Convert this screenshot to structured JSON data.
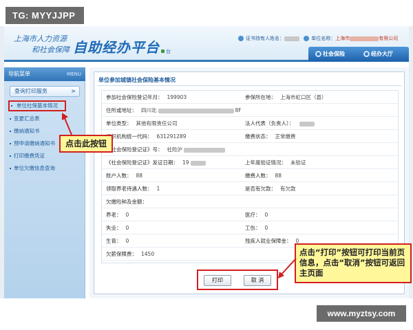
{
  "watermark_top": "TG: MYYJJPP",
  "watermark_bottom": "www.myztsy.com",
  "header": {
    "logo_line1": "上海市人力资源",
    "logo_line2": "和社会保障",
    "app_title": "自助经办平台",
    "sound_label": "台",
    "user_label": "证书持有人姓名：",
    "company_label": "单位名称：",
    "company_value": "上海市",
    "company_suffix": "有限公司"
  },
  "nav": [
    {
      "label": "社会保险"
    },
    {
      "label": "经办大厅"
    }
  ],
  "sidebar": {
    "title": "导航菜单",
    "menu_label": "MENU",
    "group_label": "查询打印服务",
    "items": [
      {
        "label": "单位社保基本情况"
      },
      {
        "label": "变更汇总表"
      },
      {
        "label": "缴纳通知书"
      },
      {
        "label": "预申请缴纳通知书"
      },
      {
        "label": "打印缴费凭证"
      },
      {
        "label": "单位欠缴信息查询"
      }
    ]
  },
  "panel": {
    "title": "单位参加城镇社会保险基本情况",
    "rows": [
      {
        "l1": "参加社会保险登记年月：",
        "v1": "199903",
        "l2": "参保所在地：",
        "v2": "上海市虹口区（县）"
      },
      {
        "l1": "住所或地址：",
        "v1": "四川北",
        "v1b": "8F",
        "l2": "",
        "v2": ""
      },
      {
        "l1": "单位类型：",
        "v1": "其他有限责任公司",
        "l2": "法人代表（负责人）：",
        "v2": ""
      },
      {
        "l1": "组织机构统一代码：",
        "v1": "631291289",
        "l2": "缴费状态：",
        "v2": "正常缴费"
      },
      {
        "l1": "《社会保险登记证》号：",
        "v1": "社险沪",
        "l2": "",
        "v2": ""
      },
      {
        "l1": "《社会保险登记证》发证日期：",
        "v1": "19",
        "l2": "上年度验证情况：",
        "v2": "未验证"
      },
      {
        "l1": "账户人数：",
        "v1": "88",
        "l2": "缴费人数：",
        "v2": "88"
      },
      {
        "l1": "领取养老待遇人数：",
        "v1": "1",
        "l2": "是否有欠款：",
        "v2": "有欠款"
      },
      {
        "l1": "欠缴险种及金额：",
        "v1": "",
        "l2": "",
        "v2": ""
      },
      {
        "l1": "养老：",
        "v1": "0",
        "l2": "医疗：",
        "v2": "0"
      },
      {
        "l1": "失业：",
        "v1": "0",
        "l2": "工伤：",
        "v2": "0"
      },
      {
        "l1": "生育：",
        "v1": "0",
        "l2": "残疾人就业保障金：",
        "v2": "0"
      },
      {
        "l1": "欠薪保障费：",
        "v1": "1450",
        "l2": "",
        "v2": ""
      }
    ],
    "print_label": "打印",
    "cancel_label": "取 消"
  },
  "callouts": {
    "click_button": "点击此按钮",
    "print_hint": "点击“打印”按钮可打印当前页信息，点击“取消”按钮可返回主页面"
  },
  "colors": {
    "brand_blue": "#2f78b8",
    "highlight_red": "#d21e1e",
    "callout_yellow": "#fff79a"
  }
}
